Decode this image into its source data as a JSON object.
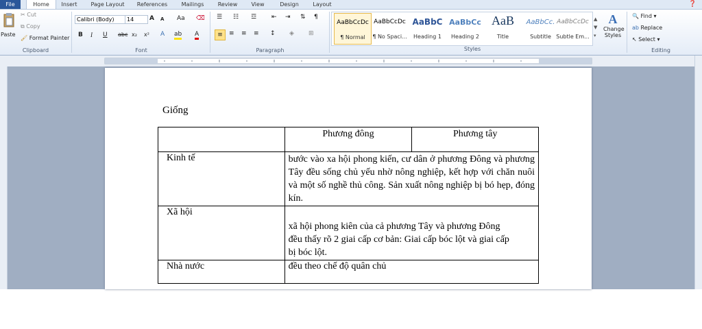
{
  "tabs": [
    "File",
    "Home",
    "Insert",
    "Page Layout",
    "References",
    "Mailings",
    "Review",
    "View",
    "Design",
    "Layout"
  ],
  "clipboard": {
    "paste": "Paste",
    "cut": "Cut",
    "copy": "Copy",
    "format_painter": "Format Painter",
    "label": "Clipboard"
  },
  "font": {
    "name": "Calibri (Body)",
    "size": "14",
    "label": "Font",
    "bold": "B",
    "italic": "I",
    "underline": "U",
    "strike": "abc",
    "subscript": "x₂",
    "superscript": "x²",
    "grow": "A",
    "shrink": "A",
    "case": "Aa"
  },
  "paragraph": {
    "label": "Paragraph"
  },
  "styles": {
    "label": "Styles",
    "items": [
      {
        "preview": "AaBbCcDc",
        "name": "¶ Normal"
      },
      {
        "preview": "AaBbCcDc",
        "name": "¶ No Spaci..."
      },
      {
        "preview": "AaBbC",
        "name": "Heading 1"
      },
      {
        "preview": "AaBbCc",
        "name": "Heading 2"
      },
      {
        "preview": "AaB",
        "name": "Title"
      },
      {
        "preview": "AaBbCc.",
        "name": "Subtitle"
      },
      {
        "preview": "AaBbCcDc",
        "name": "Subtle Em..."
      }
    ],
    "change_styles": "Change Styles"
  },
  "editing": {
    "find": "Find",
    "replace": "Replace",
    "select": "Select",
    "label": "Editing"
  },
  "document": {
    "heading": "Giống",
    "table": {
      "headers": [
        "",
        "Phương đông",
        "Phương tây"
      ],
      "rows": [
        {
          "label": "Kinh tế",
          "text": "bước vào xa hội phong kiến, cư dân ở phương Đông và phương Tây đều sống chủ yếu nhờ nông nghiệp, kết hợp với chăn nuôi và một số nghề thủ công. Sản xuất nông nghiệp bị bó hẹp, đóng kín."
        },
        {
          "label": "Xã hội",
          "text": "xã hội phong kiên của cả phương Tây và phương Đông đều thấy rõ 2 giai cấp cơ bản: Giai cấp bóc lột và giai cấp bị bóc lột."
        },
        {
          "label": "Nhà nước",
          "text": "đều theo chế độ quân chủ"
        }
      ]
    }
  }
}
